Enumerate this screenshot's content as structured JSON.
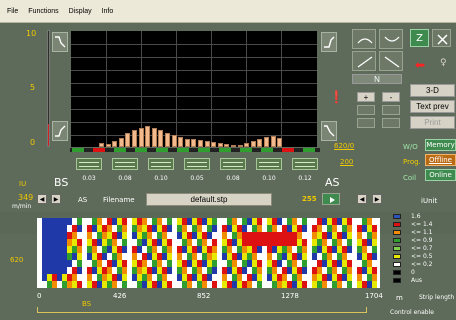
{
  "menu": [
    "File",
    "Functions",
    "Display",
    "Info"
  ],
  "left_axis": {
    "top": "10",
    "mid": "5",
    "low": "0",
    "unit": "IU",
    "bs": "BS",
    "as": "AS"
  },
  "chart": {
    "bins": 28,
    "heights": [
      4,
      3,
      6,
      9,
      14,
      17,
      19,
      21,
      19,
      17,
      14,
      12,
      10,
      8,
      8,
      7,
      6,
      5,
      4,
      3,
      2,
      2,
      4,
      6,
      8,
      10,
      11,
      9
    ],
    "values_row": [
      "0.03",
      "0.08",
      "0.10",
      "0.05",
      "0.08",
      "0.10",
      "0.12"
    ]
  },
  "right_panel": {
    "button_n": "N",
    "plus": "+",
    "minus": "-",
    "label_3d": "3-D",
    "text_prev": "Text prev",
    "print": "Print",
    "status_620": "620/0",
    "status_200": "200",
    "wo": "W/O",
    "prog": "Prog.",
    "coil": "Coil",
    "memory": "Memory",
    "offline1": "Offline",
    "online": "Online",
    "z": "Z"
  },
  "lower": {
    "speed_value": "349",
    "speed_unit": "m/min",
    "as_label": "AS",
    "filename_label": "Filename",
    "filename_value": "default.stp",
    "count": "255",
    "y620": "620",
    "scale_title": "iUnit",
    "scale": [
      "1.6",
      "<= 1.4",
      "<= 1.1",
      "<= 0.9",
      "<= 0.7",
      "<= 0.5",
      "<= 0.2",
      "0",
      "Aus"
    ],
    "x_labels": [
      "0",
      "426",
      "852",
      "1278",
      "1704"
    ],
    "bs_label": "BS",
    "m_label": "m",
    "strip_label": "Strip length",
    "control_enable": "Control enable"
  },
  "colors": {
    "accent_yellow": "#f0c800",
    "bar_fill": "#f3bb8d",
    "blue": "#1f3aa8",
    "green": "#2e9e2e",
    "yellow": "#e7e800",
    "orange": "#f28c00",
    "red": "#d11",
    "white": "#ffffff"
  }
}
